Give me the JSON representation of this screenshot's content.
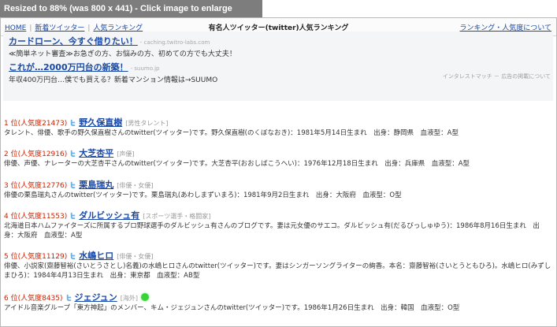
{
  "resize_bar": {
    "text": "Resized to 88% (was 800 x 441) - Click image to enlarge"
  },
  "nav": {
    "home": "HOME",
    "new": "新着ツイッター",
    "popular": "人気ランキング",
    "title": "有名人ツイッター(twitter)人気ランキング",
    "about": "ランキング・人気度について"
  },
  "ads": [
    {
      "title": "カードローン、今すぐ借りたい！",
      "source": "- caching.twitro-labs.com",
      "desc": "≪簡単ネット審査≫お急ぎの方、お悩みの方、初めての方でも大丈夫！"
    },
    {
      "title": "これが…2000万円台の新築！",
      "source": "- suumo.jp",
      "desc": "年収400万円台…僕でも買える？新着マンション情報は→SUUMO"
    }
  ],
  "ad_note": "インタレストマッチ － 広告の掲載について",
  "rankings": [
    {
      "num": "1 位(人気度21473)",
      "name": "野久保直樹",
      "category": "[男性タレント]",
      "online": false,
      "desc": "タレント、俳優、歌手の野久保直樹さんのtwitter(ツイッター)です。野久保直樹(のくぼなおき)：1981年5月14日生まれ　出身：静岡県　血液型：A型"
    },
    {
      "num": "2 位(人気度12916)",
      "name": "大芝杏平",
      "category": "[声優]",
      "online": false,
      "desc": "俳優、声優、ナレーターの大芝杏平さんのtwitter(ツイッター)です。大芝杏平(おおしばこうへい)：1976年12月18日生まれ　出身：兵庫県　血液型：A型"
    },
    {
      "num": "3 位(人気度12776)",
      "name": "栗島瑞丸",
      "category": "[俳優・女優]",
      "online": false,
      "desc": "俳優の栗島瑞丸さんのtwitter(ツイッター)です。栗島瑞丸(あわしまずいまろ)：1981年9月2日生まれ　出身：大阪府　血液型：O型"
    },
    {
      "num": "4 位(人気度11553)",
      "name": "ダルビッシュ有",
      "category": "[スポーツ選手・格闘家]",
      "online": false,
      "desc": "北海道日本ハムファイターズに所属するプロ野球選手のダルビッシュ有さんのブログです。妻は元女優のサエコ。ダルビッシュ有(だるびっしゅゆう)：1986年8月16日生まれ　出身：大阪府　血液型：A型"
    },
    {
      "num": "5 位(人気度11129)",
      "name": "水嶋ヒロ",
      "category": "[俳優・女優]",
      "online": false,
      "desc": "俳優、小説家(齋藤智裕(さいとうさとし)名義)の水嶋ヒロさんのtwitter(ツイッター)です。妻はシンガーソングライターの絢香。本名：齋藤智裕(さいとうともひろ)。水嶋ヒロ(みずしまひろ)：1984年4月13日生まれ　出身：東京都　血液型：AB型"
    },
    {
      "num": "6 位(人気度8435)",
      "name": "ジェジュン",
      "category": "[海外]",
      "online": true,
      "desc": "アイドル音楽グループ「東方神起」のメンバー、キム・ジェジュンさんのtwitter(ツイッター)です。1986年1月26日生まれ　出身：韓国　血液型：O型"
    }
  ],
  "colors": {
    "link": "#1a4aa8",
    "rank_number": "#cc2200",
    "online": "#3ad43a"
  }
}
